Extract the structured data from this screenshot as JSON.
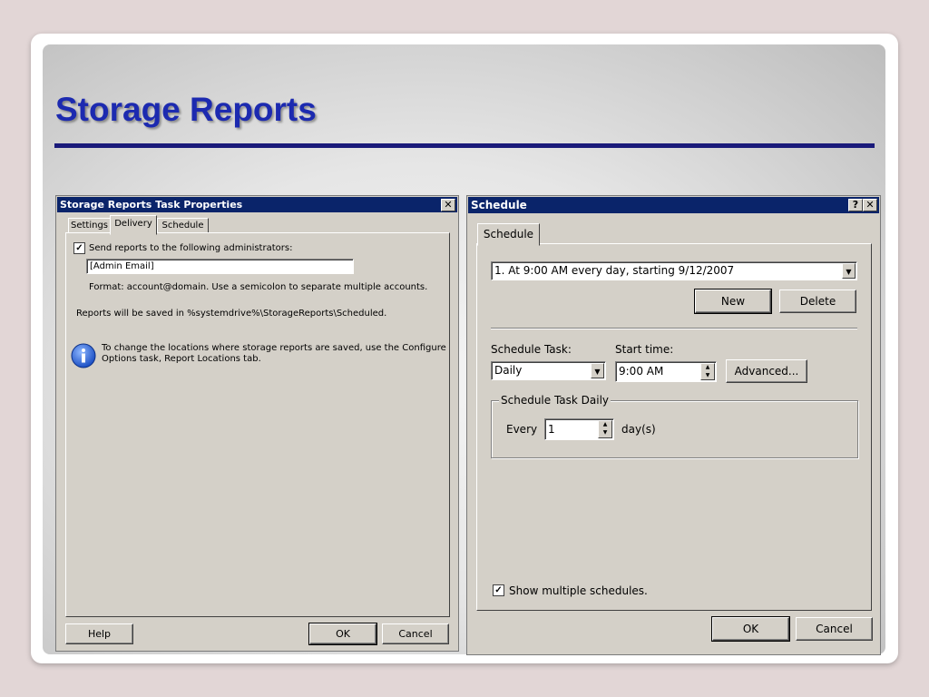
{
  "slide": {
    "title": "Storage Reports"
  },
  "left_window": {
    "title": "Storage Reports Task Properties",
    "close_label": "✕",
    "tabs": [
      {
        "label": "Settings"
      },
      {
        "label": "Delivery"
      },
      {
        "label": "Schedule"
      }
    ],
    "send_reports_label": "Send reports to the following administrators:",
    "send_reports_checked": true,
    "admin_email_value": "[Admin Email]",
    "format_text": "Format: account@domain. Use a semicolon to separate multiple accounts.",
    "saved_text": "Reports will be saved in %systemdrive%\\StorageReports\\Scheduled.",
    "info_text_line1": "To change the locations where storage reports are saved, use the Configure",
    "info_text_line2": "Options task, Report Locations tab.",
    "info_icon_glyph": "i",
    "help_button": "Help",
    "ok_button": "OK",
    "cancel_button": "Cancel"
  },
  "right_window": {
    "title": "Schedule",
    "help_label": "?",
    "close_label": "✕",
    "tab_label": "Schedule",
    "schedule_selected": "1. At 9:00 AM every day, starting 9/12/2007",
    "new_button": "New",
    "delete_button": "Delete",
    "schedule_task_label": "Schedule Task:",
    "schedule_task_value": "Daily",
    "start_time_label": "Start time:",
    "start_time_value": "9:00 AM",
    "advanced_button": "Advanced...",
    "group_label": "Schedule Task Daily",
    "every_label": "Every",
    "every_value": "1",
    "days_label": "day(s)",
    "show_multiple_label": "Show multiple schedules.",
    "show_multiple_checked": true,
    "ok_button": "OK",
    "cancel_button": "Cancel"
  },
  "icons": {
    "dropdown": "▼",
    "spin_up": "▲",
    "spin_down": "▼",
    "check": "✓"
  },
  "colors": {
    "title_blue": "#1c2ab0",
    "rule": "#1a1a7a",
    "titlebar": "#0a246a",
    "window_bg": "#d4d0c8"
  }
}
